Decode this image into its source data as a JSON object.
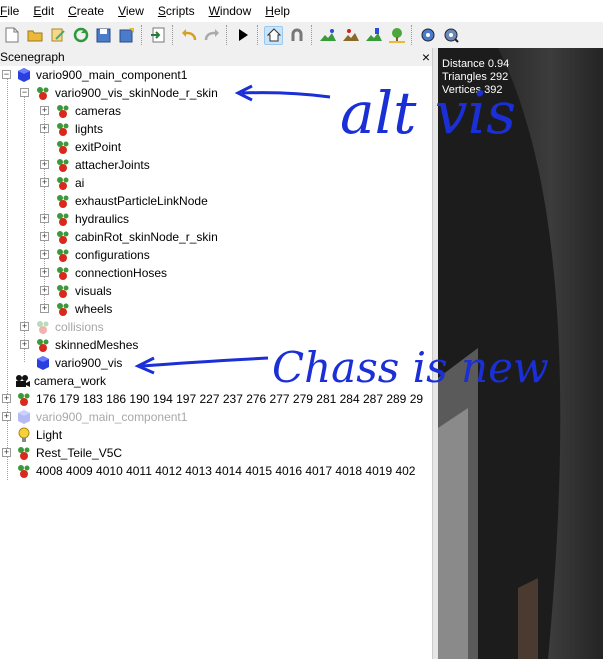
{
  "menu": {
    "items": [
      {
        "label": "File",
        "u": "F",
        "rest": "ile"
      },
      {
        "label": "Edit",
        "u": "E",
        "rest": "dit"
      },
      {
        "label": "Create",
        "u": "C",
        "rest": "reate"
      },
      {
        "label": "View",
        "u": "V",
        "rest": "iew"
      },
      {
        "label": "Scripts",
        "u": "S",
        "rest": "cripts"
      },
      {
        "label": "Window",
        "u": "W",
        "rest": "indow"
      },
      {
        "label": "Help",
        "u": "H",
        "rest": "elp"
      }
    ]
  },
  "panel": {
    "title": "Scenegraph",
    "close": "×"
  },
  "tree": {
    "n0": "vario900_main_component1",
    "n1": "vario900_vis_skinNode_r_skin",
    "n2": "cameras",
    "n3": "lights",
    "n4": "exitPoint",
    "n5": "attacherJoints",
    "n6": "ai",
    "n7": "exhaustParticleLinkNode",
    "n8": "hydraulics",
    "n9": "cabinRot_skinNode_r_skin",
    "n10": "configurations",
    "n11": "connectionHoses",
    "n12": "visuals",
    "n13": "wheels",
    "n14": "collisions",
    "n15": "skinnedMeshes",
    "n16": "vario900_vis",
    "n17": "camera_work",
    "n18": "176 179 183 186 190 194 197 227 237 276 277 279 281 284 287 289 29",
    "n19": "vario900_main_component1",
    "n20": "Light",
    "n21": "Rest_Teile_V5C",
    "n22": "4008 4009 4010 4011 4012 4013 4014 4015 4016 4017 4018 4019 402"
  },
  "viewport": {
    "distance": "Distance 0.94",
    "triangles": "Triangles 292",
    "vertices": "Vertices 392"
  },
  "annotations": {
    "a1": "alt vis",
    "a2": "Chass is new"
  },
  "colors": {
    "ink": "#1a2fd6",
    "transform_red": "#d8291c",
    "transform_green": "#3a9a3a",
    "shape_blue": "#2a3fe0"
  }
}
